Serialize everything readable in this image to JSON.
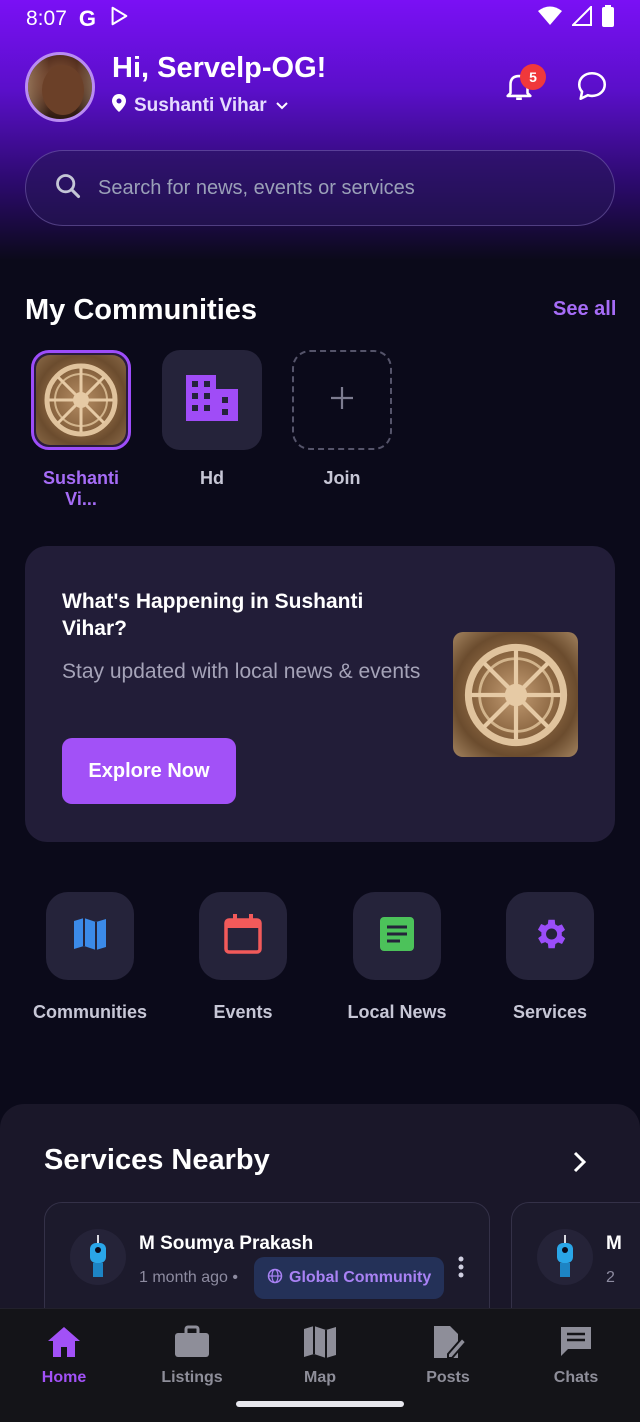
{
  "status_bar": {
    "time": "8:07",
    "g_label": "G"
  },
  "header": {
    "greeting": "Hi, Servelp-OG!",
    "location": "Sushanti Vihar",
    "notification_count": "5"
  },
  "search": {
    "placeholder": "Search for news, events or services"
  },
  "communities": {
    "title": "My Communities",
    "see_all": "See all",
    "items": [
      {
        "label": "Sushanti Vi..."
      },
      {
        "label": "Hd"
      },
      {
        "label": "Join"
      }
    ]
  },
  "happening": {
    "title": "What's Happening in Sushanti Vihar?",
    "subtitle": "Stay updated with local news & events",
    "button": "Explore Now"
  },
  "quick_links": [
    {
      "label": "Communities",
      "icon": "map-icon",
      "color": "#3b8ae8"
    },
    {
      "label": "Events",
      "icon": "calendar-icon",
      "color": "#f25a5a"
    },
    {
      "label": "Local News",
      "icon": "news-icon",
      "color": "#4cc25a"
    },
    {
      "label": "Services",
      "icon": "gear-icon",
      "color": "#9b4dfa"
    }
  ],
  "services_nearby": {
    "title": "Services Nearby",
    "card": {
      "name": "M Soumya Prakash",
      "time": "1 month ago •",
      "chip": "Global Community"
    },
    "card2": {
      "name_initial": "M",
      "time_initial": "2"
    }
  },
  "bottom_nav": [
    {
      "label": "Home",
      "active": true
    },
    {
      "label": "Listings"
    },
    {
      "label": "Map"
    },
    {
      "label": "Posts"
    },
    {
      "label": "Chats"
    }
  ],
  "colors": {
    "accent": "#a251f7",
    "badge": "#f0383b",
    "background": "#0b0a1a"
  }
}
